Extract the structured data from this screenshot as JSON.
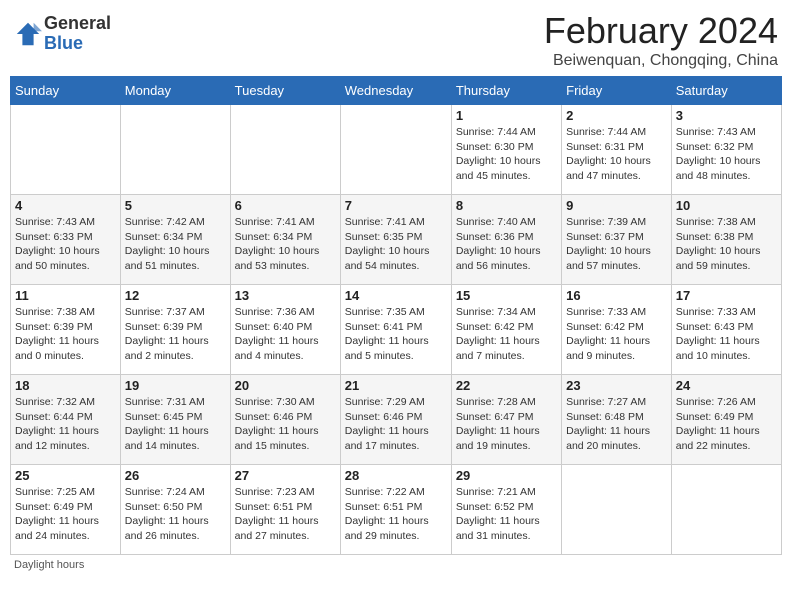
{
  "logo": {
    "general": "General",
    "blue": "Blue"
  },
  "title": "February 2024",
  "location": "Beiwenquan, Chongqing, China",
  "weekdays": [
    "Sunday",
    "Monday",
    "Tuesday",
    "Wednesday",
    "Thursday",
    "Friday",
    "Saturday"
  ],
  "weeks": [
    [
      null,
      null,
      null,
      null,
      {
        "day": 1,
        "sunrise": "7:44 AM",
        "sunset": "6:30 PM",
        "daylight": "10 hours and 45 minutes."
      },
      {
        "day": 2,
        "sunrise": "7:44 AM",
        "sunset": "6:31 PM",
        "daylight": "10 hours and 47 minutes."
      },
      {
        "day": 3,
        "sunrise": "7:43 AM",
        "sunset": "6:32 PM",
        "daylight": "10 hours and 48 minutes."
      }
    ],
    [
      {
        "day": 4,
        "sunrise": "7:43 AM",
        "sunset": "6:33 PM",
        "daylight": "10 hours and 50 minutes."
      },
      {
        "day": 5,
        "sunrise": "7:42 AM",
        "sunset": "6:34 PM",
        "daylight": "10 hours and 51 minutes."
      },
      {
        "day": 6,
        "sunrise": "7:41 AM",
        "sunset": "6:34 PM",
        "daylight": "10 hours and 53 minutes."
      },
      {
        "day": 7,
        "sunrise": "7:41 AM",
        "sunset": "6:35 PM",
        "daylight": "10 hours and 54 minutes."
      },
      {
        "day": 8,
        "sunrise": "7:40 AM",
        "sunset": "6:36 PM",
        "daylight": "10 hours and 56 minutes."
      },
      {
        "day": 9,
        "sunrise": "7:39 AM",
        "sunset": "6:37 PM",
        "daylight": "10 hours and 57 minutes."
      },
      {
        "day": 10,
        "sunrise": "7:38 AM",
        "sunset": "6:38 PM",
        "daylight": "10 hours and 59 minutes."
      }
    ],
    [
      {
        "day": 11,
        "sunrise": "7:38 AM",
        "sunset": "6:39 PM",
        "daylight": "11 hours and 0 minutes."
      },
      {
        "day": 12,
        "sunrise": "7:37 AM",
        "sunset": "6:39 PM",
        "daylight": "11 hours and 2 minutes."
      },
      {
        "day": 13,
        "sunrise": "7:36 AM",
        "sunset": "6:40 PM",
        "daylight": "11 hours and 4 minutes."
      },
      {
        "day": 14,
        "sunrise": "7:35 AM",
        "sunset": "6:41 PM",
        "daylight": "11 hours and 5 minutes."
      },
      {
        "day": 15,
        "sunrise": "7:34 AM",
        "sunset": "6:42 PM",
        "daylight": "11 hours and 7 minutes."
      },
      {
        "day": 16,
        "sunrise": "7:33 AM",
        "sunset": "6:42 PM",
        "daylight": "11 hours and 9 minutes."
      },
      {
        "day": 17,
        "sunrise": "7:33 AM",
        "sunset": "6:43 PM",
        "daylight": "11 hours and 10 minutes."
      }
    ],
    [
      {
        "day": 18,
        "sunrise": "7:32 AM",
        "sunset": "6:44 PM",
        "daylight": "11 hours and 12 minutes."
      },
      {
        "day": 19,
        "sunrise": "7:31 AM",
        "sunset": "6:45 PM",
        "daylight": "11 hours and 14 minutes."
      },
      {
        "day": 20,
        "sunrise": "7:30 AM",
        "sunset": "6:46 PM",
        "daylight": "11 hours and 15 minutes."
      },
      {
        "day": 21,
        "sunrise": "7:29 AM",
        "sunset": "6:46 PM",
        "daylight": "11 hours and 17 minutes."
      },
      {
        "day": 22,
        "sunrise": "7:28 AM",
        "sunset": "6:47 PM",
        "daylight": "11 hours and 19 minutes."
      },
      {
        "day": 23,
        "sunrise": "7:27 AM",
        "sunset": "6:48 PM",
        "daylight": "11 hours and 20 minutes."
      },
      {
        "day": 24,
        "sunrise": "7:26 AM",
        "sunset": "6:49 PM",
        "daylight": "11 hours and 22 minutes."
      }
    ],
    [
      {
        "day": 25,
        "sunrise": "7:25 AM",
        "sunset": "6:49 PM",
        "daylight": "11 hours and 24 minutes."
      },
      {
        "day": 26,
        "sunrise": "7:24 AM",
        "sunset": "6:50 PM",
        "daylight": "11 hours and 26 minutes."
      },
      {
        "day": 27,
        "sunrise": "7:23 AM",
        "sunset": "6:51 PM",
        "daylight": "11 hours and 27 minutes."
      },
      {
        "day": 28,
        "sunrise": "7:22 AM",
        "sunset": "6:51 PM",
        "daylight": "11 hours and 29 minutes."
      },
      {
        "day": 29,
        "sunrise": "7:21 AM",
        "sunset": "6:52 PM",
        "daylight": "11 hours and 31 minutes."
      },
      null,
      null
    ]
  ],
  "footer": "Daylight hours"
}
